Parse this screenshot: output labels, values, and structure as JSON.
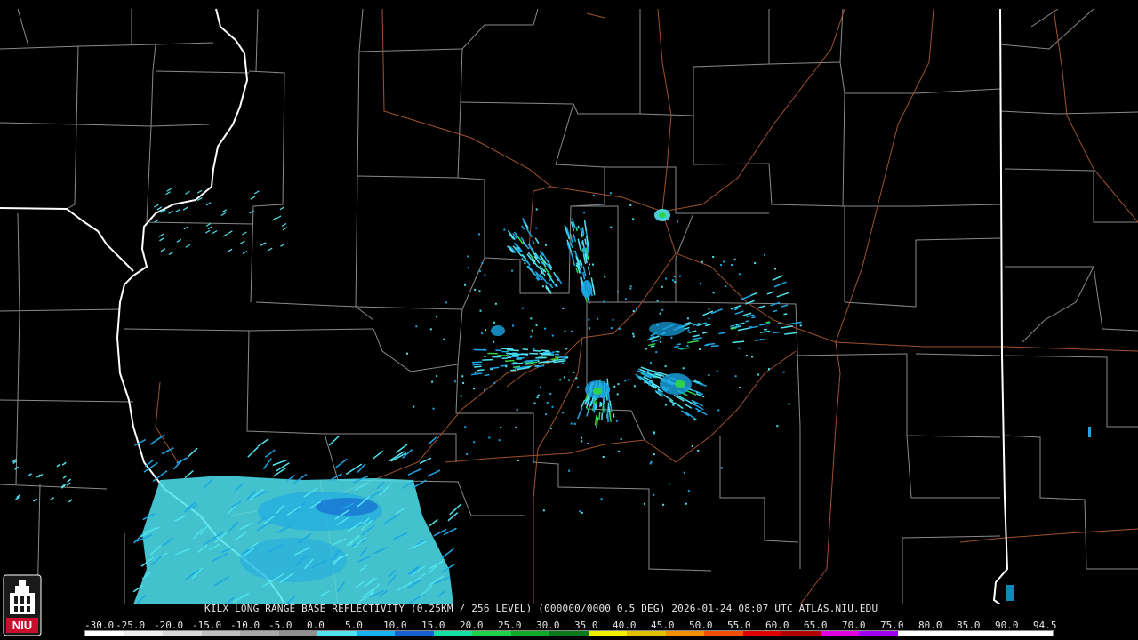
{
  "caption": "KILX LONG RANGE BASE REFLECTIVITY (0.25KM / 256 LEVEL) (000000/0000 0.5 DEG) 2026-01-24 08:07 UTC  ATLAS.NIU.EDU",
  "logo": {
    "text": "NIU",
    "icon": "university-tower-icon",
    "color": "#c8102e"
  },
  "colors": {
    "county_lines": "#8a8a8a",
    "state_lines": "#ffffff",
    "highways": "#a0522d",
    "echo_light": "#4fe3f0",
    "echo_mid": "#1aa7e6",
    "echo_dark": "#1460d0",
    "echo_green": "#2fd14a"
  },
  "scale": {
    "labels": [
      "-30.0",
      "-25.0",
      "-20.0",
      "-15.0",
      "-10.0",
      "-5.0",
      "0.0",
      "5.0",
      "10.0",
      "15.0",
      "20.0",
      "25.0",
      "30.0",
      "35.0",
      "40.0",
      "45.0",
      "50.0",
      "55.0",
      "60.0",
      "65.0",
      "70.0",
      "75.0",
      "80.0",
      "85.0",
      "90.0",
      "94.5"
    ],
    "colors": [
      "#ffffff",
      "#eeeeee",
      "#d8d8d8",
      "#c0c0c0",
      "#a8a8a8",
      "#909090",
      "#4fe3f0",
      "#1ab0f0",
      "#1460d0",
      "#14e0a0",
      "#1fd14a",
      "#12a82a",
      "#0a7a1a",
      "#f0f000",
      "#e0c000",
      "#f09000",
      "#f05000",
      "#e00000",
      "#b00000",
      "#e000e0",
      "#a000f0",
      "#ffffff",
      "#ffffff",
      "#ffffff",
      "#ffffff"
    ]
  }
}
